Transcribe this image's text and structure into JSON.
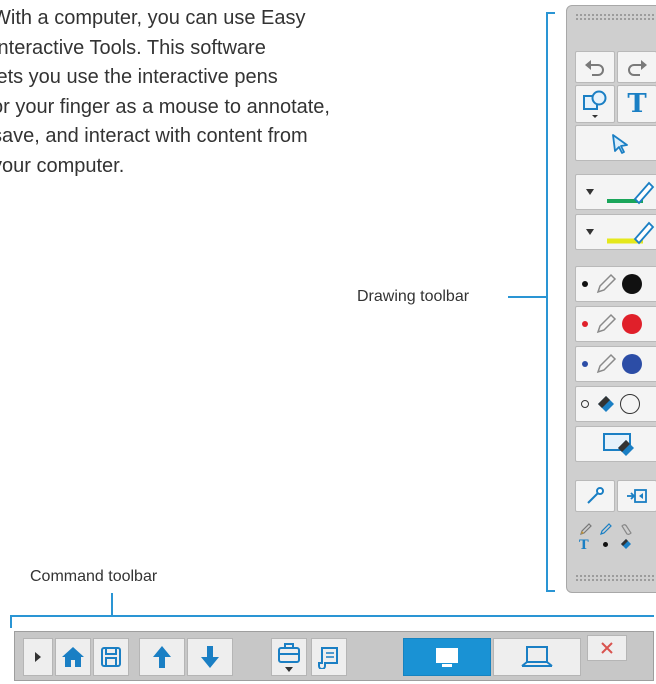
{
  "intro_lines": [
    "With a computer, you can use Easy",
    "Interactive Tools. This software",
    "lets you use the interactive pens",
    "or your finger as a mouse to annotate,",
    "save, and interact with content from",
    "your computer."
  ],
  "callouts": {
    "drawing_toolbar": "Drawing toolbar",
    "command_toolbar": "Command toolbar"
  },
  "drawing_toolbar": {
    "text_tool_glyph": "T",
    "small_text_glyph": "T",
    "pen_colors": [
      "#111111",
      "#e0202a",
      "#2c4da6"
    ],
    "marker_colors": [
      "#1aa55a",
      "#e5e81c"
    ]
  },
  "colors": {
    "accent_blue": "#1a7fc4",
    "active_blue": "#1a92d4",
    "bracket_blue": "#2a95d4",
    "close_red": "#d9534f"
  },
  "icons": {
    "command_toolbar": [
      "expand-arrow-icon",
      "home-icon",
      "save-icon",
      "page-up-icon",
      "page-down-icon",
      "toolbox-icon",
      "scroll-icon",
      "computer-mode-icon",
      "whiteboard-mode-icon",
      "close-icon"
    ]
  }
}
